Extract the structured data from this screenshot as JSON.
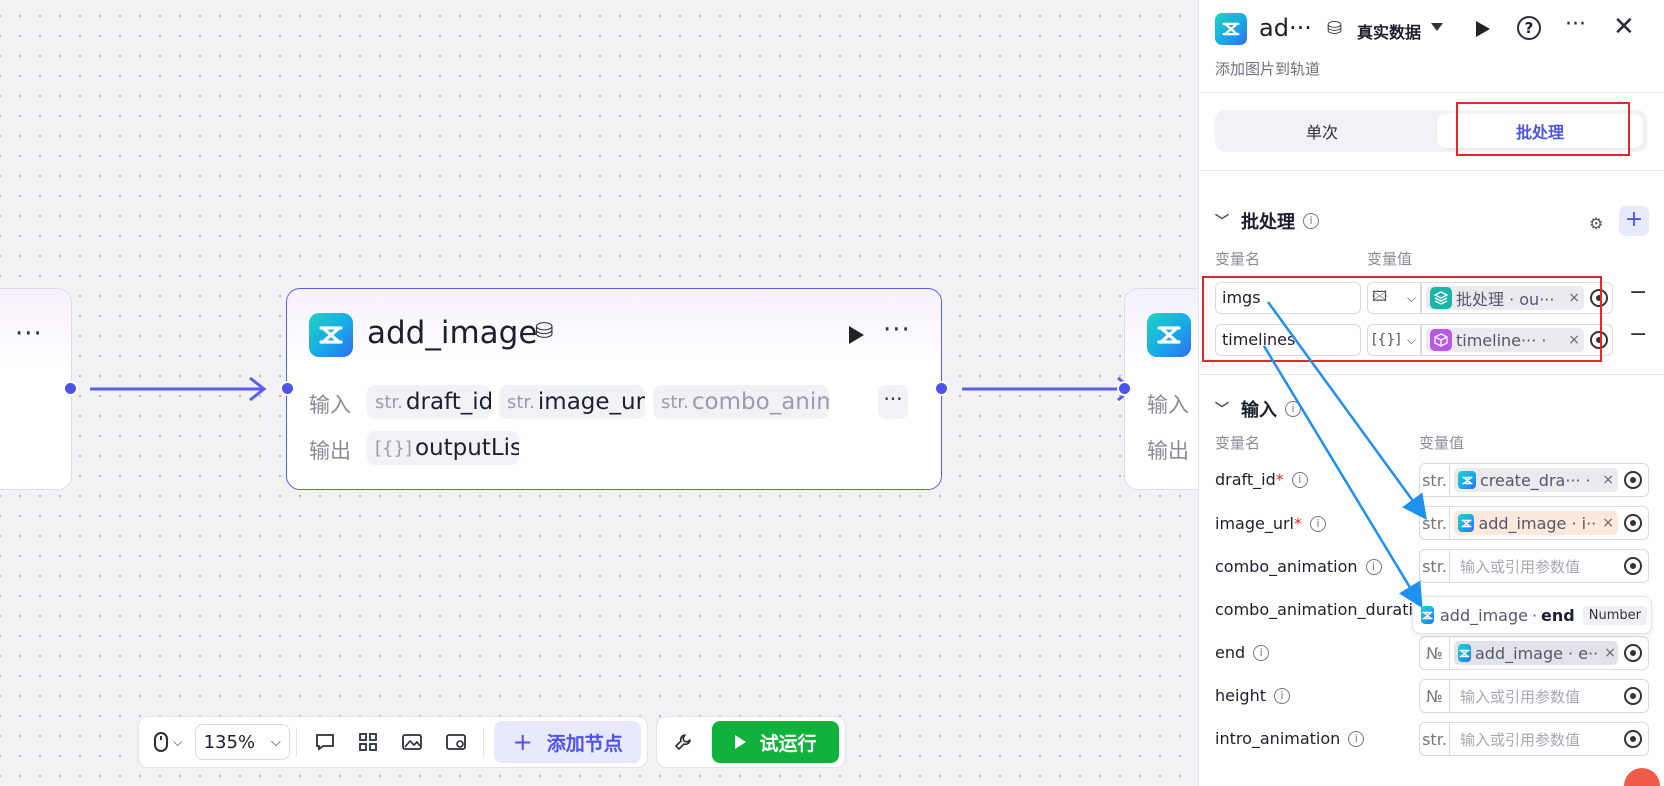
{
  "canvas": {
    "main_node": {
      "title": "add_image",
      "input_label": "输入",
      "output_label": "输出",
      "inputs": [
        {
          "type": "str.",
          "name": "draft_id"
        },
        {
          "type": "str.",
          "name": "image_url"
        },
        {
          "type": "str.",
          "name": "combo_anim"
        }
      ],
      "more_label": "···",
      "output": {
        "type": "[{}]",
        "name": "outputList"
      }
    },
    "right_node": {
      "input_label": "输入",
      "output_label": "输出"
    },
    "left_node": {
      "more_label": "···"
    }
  },
  "toolbar": {
    "zoom": "135%",
    "add_node_label": "添加节点",
    "try_run_label": "试运行"
  },
  "panel": {
    "title": "ad···",
    "data_mode": "真实数据",
    "subtitle": "添加图片到轨道",
    "tabs": [
      "单次",
      "批处理"
    ],
    "active_tab": "批处理",
    "batch": {
      "title": "批处理",
      "col_name": "变量名",
      "col_value": "变量值",
      "rows": [
        {
          "name": "imgs",
          "type_icon": "image-list",
          "ref": "批处理 · ou···"
        },
        {
          "name": "timelines",
          "type_icon": "[{}]",
          "ref": "timeline···  ·"
        }
      ]
    },
    "inputs": {
      "title": "输入",
      "col_name": "变量名",
      "col_value": "变量值",
      "rows": [
        {
          "name": "draft_id",
          "required": "*",
          "type": "str.",
          "ref": "create_dra··· ·",
          "placeholder": ""
        },
        {
          "name": "image_url",
          "required": "*",
          "type": "str.",
          "ref": "add_image · i··",
          "placeholder": ""
        },
        {
          "name": "combo_animation",
          "required": "",
          "type": "str.",
          "ref": "",
          "placeholder": "输入或引用参数值"
        },
        {
          "name": "combo_animation_duratic",
          "required": "",
          "type": "",
          "ref": "",
          "placeholder": ""
        },
        {
          "name": "end",
          "required": "",
          "type": "№",
          "ref": "add_image · e··",
          "placeholder": ""
        },
        {
          "name": "height",
          "required": "",
          "type": "№",
          "ref": "",
          "placeholder": "输入或引用参数值"
        },
        {
          "name": "intro_animation",
          "required": "",
          "type": "str.",
          "ref": "",
          "placeholder": "输入或引用参数值"
        }
      ]
    },
    "suggestion": {
      "node": "add_image",
      "sep": "·",
      "field": "end",
      "type": "Number"
    }
  },
  "colors": {
    "accent": "#4d54e8",
    "run_green": "#0fb23a",
    "highlight_red": "#e02a2a",
    "arrow_blue": "#1e90f0"
  }
}
